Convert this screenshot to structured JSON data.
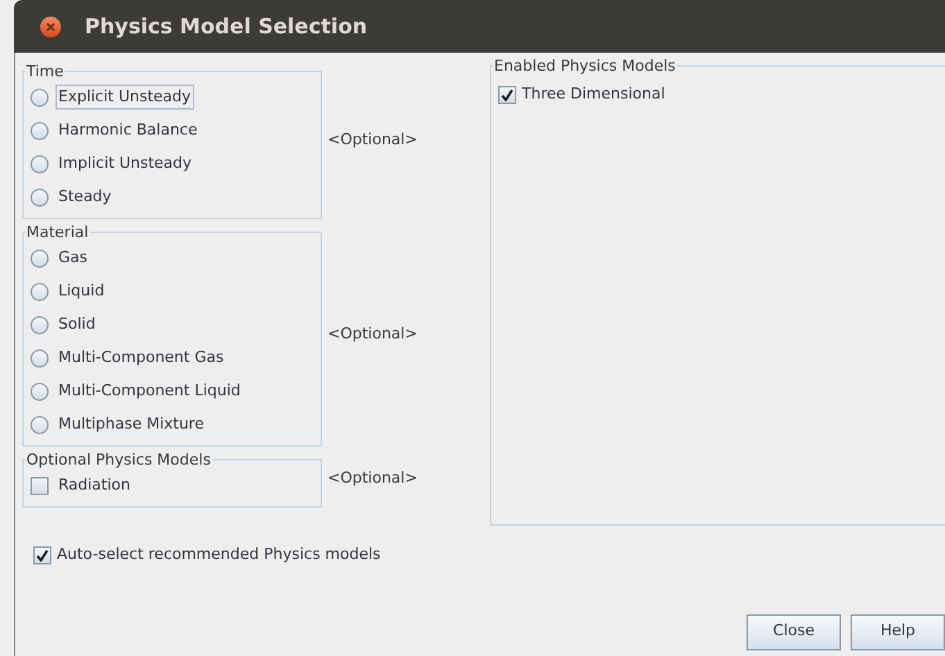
{
  "window": {
    "title": "Physics Model Selection"
  },
  "groups": [
    {
      "title": "Time",
      "kind": "radio",
      "optional_label": "<Optional>",
      "options": [
        {
          "label": "Explicit Unsteady",
          "selected": false,
          "focused": true
        },
        {
          "label": "Harmonic Balance",
          "selected": false,
          "focused": false
        },
        {
          "label": "Implicit Unsteady",
          "selected": false,
          "focused": false
        },
        {
          "label": "Steady",
          "selected": false,
          "focused": false
        }
      ]
    },
    {
      "title": "Material",
      "kind": "radio",
      "optional_label": "<Optional>",
      "options": [
        {
          "label": "Gas",
          "selected": false,
          "focused": false
        },
        {
          "label": "Liquid",
          "selected": false,
          "focused": false
        },
        {
          "label": "Solid",
          "selected": false,
          "focused": false
        },
        {
          "label": "Multi-Component Gas",
          "selected": false,
          "focused": false
        },
        {
          "label": "Multi-Component Liquid",
          "selected": false,
          "focused": false
        },
        {
          "label": "Multiphase Mixture",
          "selected": false,
          "focused": false
        }
      ]
    },
    {
      "title": "Optional Physics Models",
      "kind": "checkbox",
      "optional_label": "<Optional>",
      "options": [
        {
          "label": "Radiation",
          "checked": false
        }
      ]
    }
  ],
  "enabled_models": {
    "title": "Enabled Physics Models",
    "items": [
      {
        "label": "Three Dimensional",
        "checked": true
      }
    ]
  },
  "auto_select": {
    "label": "Auto-select recommended Physics models",
    "checked": true
  },
  "buttons": [
    "Close",
    "Help"
  ]
}
